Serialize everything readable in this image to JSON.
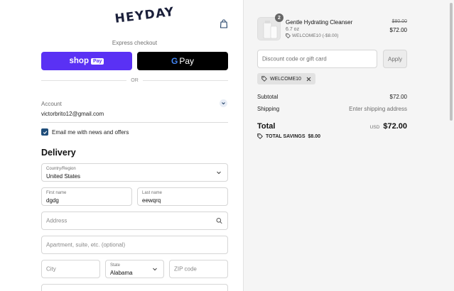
{
  "brand": {
    "logo_text": "HEYDAY"
  },
  "express": {
    "label": "Express checkout",
    "shoppay_label": "shop",
    "shoppay_badge": "Pay",
    "gpay_g": "G",
    "gpay_label": "Pay",
    "or_label": "OR"
  },
  "account": {
    "label": "Account",
    "email": "victorbrito12@gmail.com"
  },
  "newsletter": {
    "label": "Email me with news and offers",
    "checked": true
  },
  "delivery": {
    "heading": "Delivery",
    "country_label": "Country/Region",
    "country_value": "United States",
    "first_name_label": "First name",
    "first_name_value": "dgdg",
    "last_name_label": "Last name",
    "last_name_value": "eewqrq",
    "address_placeholder": "Address",
    "apartment_placeholder": "Apartment, suite, etc. (optional)",
    "city_placeholder": "City",
    "state_label": "State",
    "state_value": "Alabama",
    "zip_placeholder": "ZIP code"
  },
  "summary": {
    "product": {
      "quantity": "2",
      "name": "Gentle Hydrating Cleanser",
      "variant": "6.7 oz",
      "discount": "WELCOME10 (-$8.00)",
      "original_price": "$80.00",
      "price": "$72.00"
    },
    "discount_placeholder": "Discount code or gift card",
    "apply_label": "Apply",
    "applied_code": "WELCOME10",
    "subtotal_label": "Subtotal",
    "subtotal_value": "$72.00",
    "shipping_label": "Shipping",
    "shipping_value": "Enter shipping address",
    "total_label": "Total",
    "total_currency": "USD",
    "total_value": "$72.00",
    "savings_label": "TOTAL SAVINGS",
    "savings_value": "$8.00"
  },
  "colors": {
    "shoppay": "#5a31f4",
    "gpay": "#000000",
    "checkbox": "#1f4d7a",
    "summary_bg": "#f5f5f5"
  }
}
